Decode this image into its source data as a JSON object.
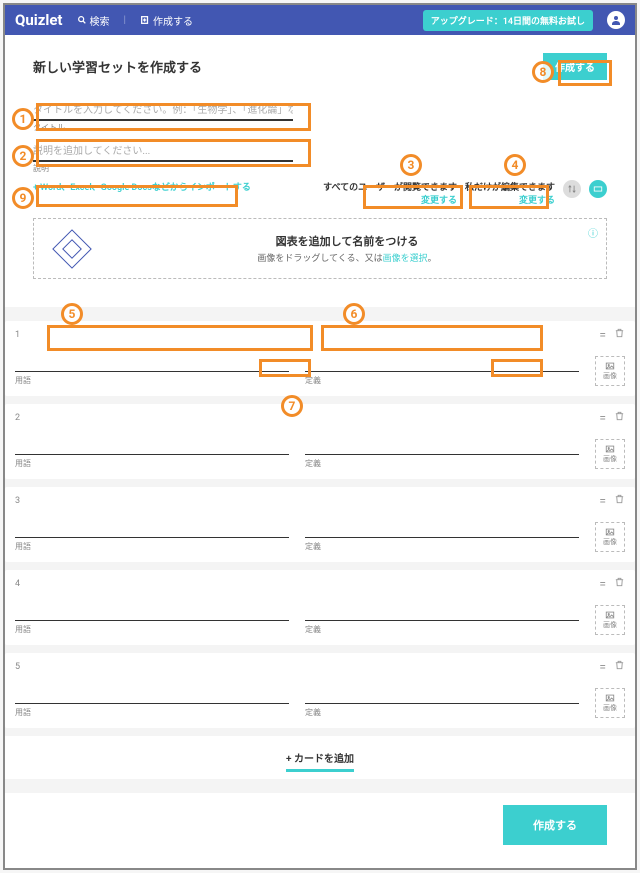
{
  "topbar": {
    "brand": "Quizlet",
    "search": "検索",
    "create": "作成する",
    "upgrade": "アップグレード：14日間の無料お試し"
  },
  "header": {
    "title": "新しい学習セットを作成する",
    "create": "作成する"
  },
  "title_field": {
    "placeholder": "タイトルを入力してください。例：「生物学」、「進化論」など",
    "label": "タイトル"
  },
  "desc_field": {
    "placeholder": "説明を追加してください...",
    "label": "説明"
  },
  "import": "+ Word、Excel、Google Docsなどからインポートする",
  "visibility": {
    "view_title": "すべてのユーザーが閲覧できます",
    "edit_title": "私だけが編集できます",
    "change": "変更する"
  },
  "diagram": {
    "title": "図表を追加して名前をつける",
    "sub_pre": "画像をドラッグしてくる、又は",
    "sub_link": "画像を選択",
    "sub_post": "。"
  },
  "card": {
    "term": "用語",
    "def": "定義",
    "img": "画像"
  },
  "cards": [
    {
      "n": "1"
    },
    {
      "n": "2"
    },
    {
      "n": "3"
    },
    {
      "n": "4"
    },
    {
      "n": "5"
    }
  ],
  "add_card": "+ カードを追加",
  "footer_create": "作成する",
  "ann": {
    "1": "1",
    "2": "2",
    "3": "3",
    "4": "4",
    "5": "5",
    "6": "6",
    "7": "7",
    "8": "8",
    "9": "9"
  }
}
